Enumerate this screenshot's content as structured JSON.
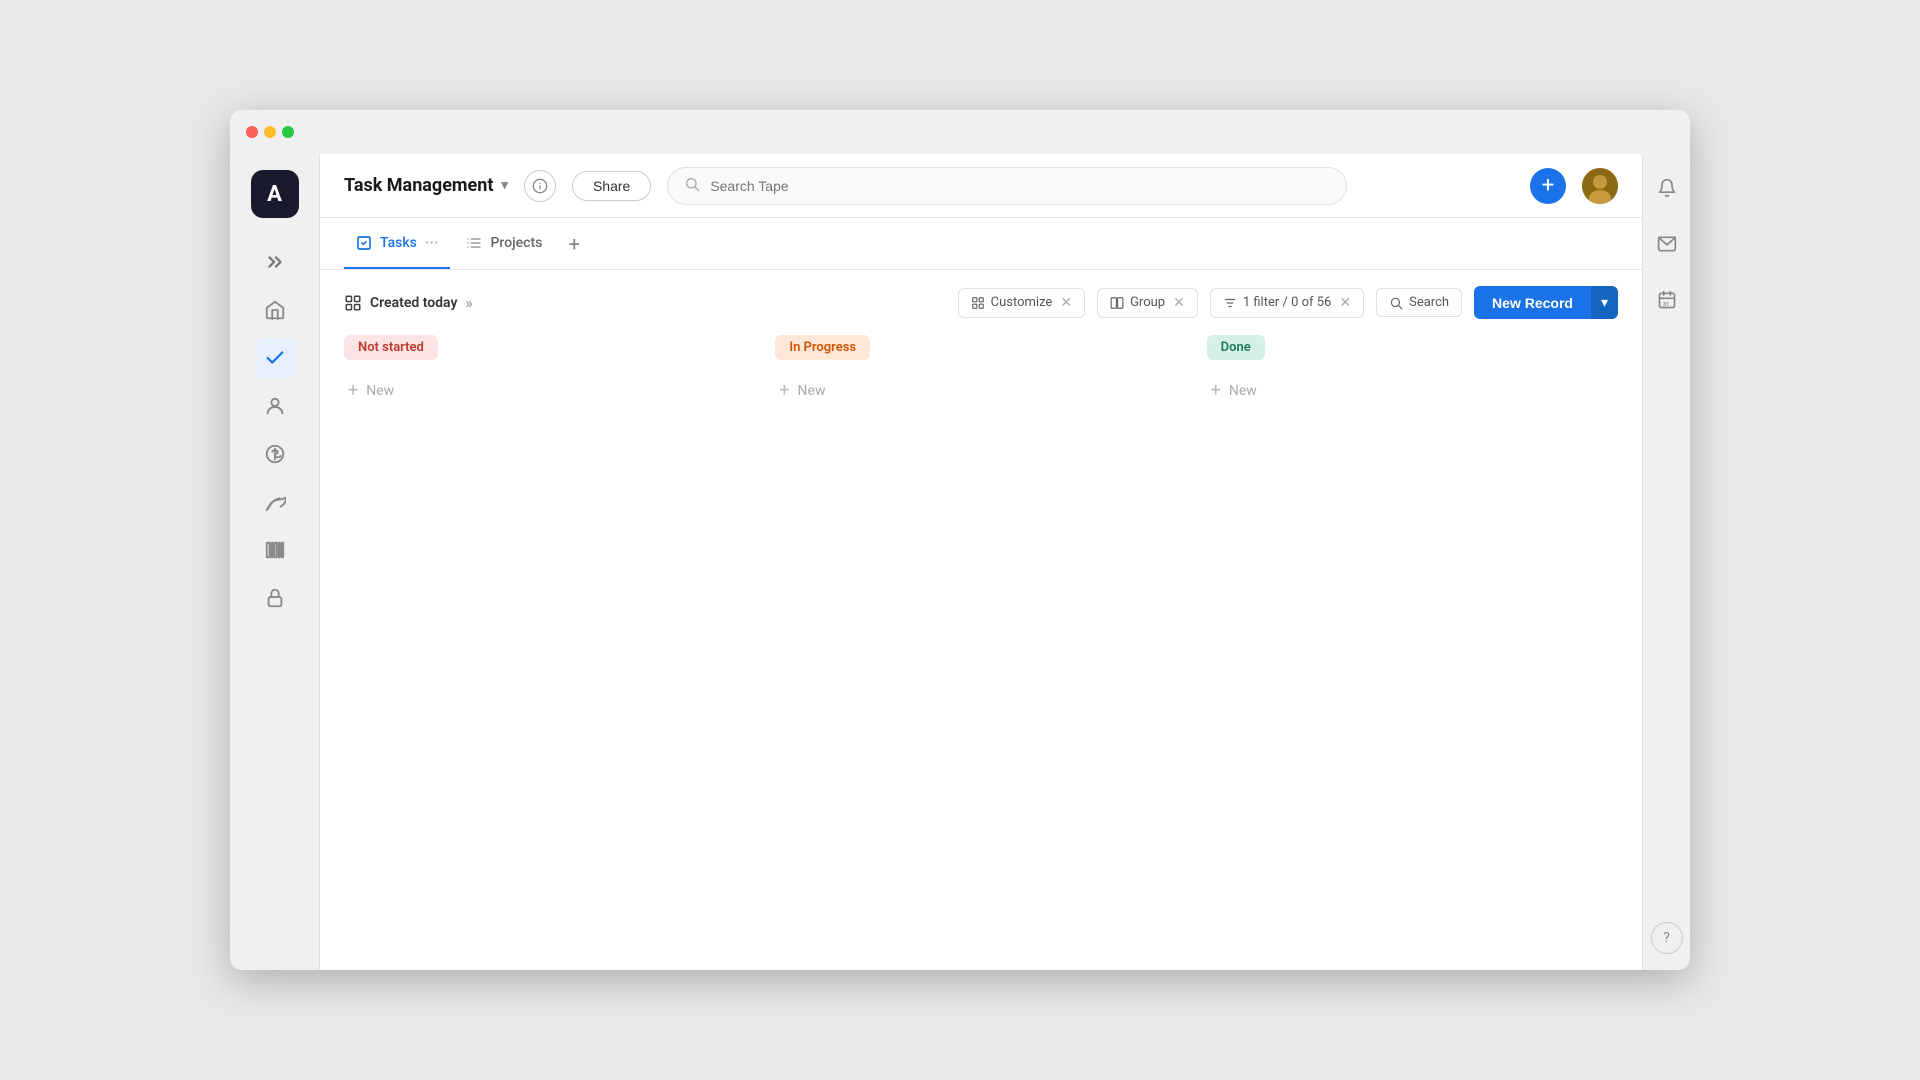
{
  "window": {
    "title": "Task Management"
  },
  "titlebar": {
    "traffic_lights": [
      "red",
      "yellow",
      "green"
    ]
  },
  "topbar": {
    "app_title": "Task Management",
    "chevron_label": "▾",
    "info_label": "ⓘ",
    "share_label": "Share",
    "search_placeholder": "Search Tape",
    "plus_label": "+"
  },
  "tabs": [
    {
      "id": "tasks",
      "label": "Tasks",
      "active": true
    },
    {
      "id": "projects",
      "label": "Projects",
      "active": false
    }
  ],
  "toolbar": {
    "created_today_label": "Created today",
    "customize_label": "Customize",
    "group_label": "Group",
    "filter_label": "1 filter / 0 of 56",
    "search_label": "Search",
    "new_record_label": "New Record"
  },
  "board": {
    "columns": [
      {
        "id": "not-started",
        "label": "Not started",
        "style": "not-started",
        "new_label": "New"
      },
      {
        "id": "in-progress",
        "label": "In Progress",
        "style": "in-progress",
        "new_label": "New"
      },
      {
        "id": "done",
        "label": "Done",
        "style": "done",
        "new_label": "New"
      }
    ]
  },
  "right_sidebar": {
    "icons": [
      {
        "id": "bell",
        "symbol": "🔔"
      },
      {
        "id": "mail",
        "symbol": "✉"
      },
      {
        "id": "calendar",
        "symbol": "📅"
      }
    ],
    "help_label": "?"
  },
  "left_sidebar": {
    "logo_label": "A",
    "icons": [
      {
        "id": "expand",
        "symbol": "⟫",
        "active": false
      },
      {
        "id": "home",
        "symbol": "⌂",
        "active": false
      },
      {
        "id": "tasks-check",
        "symbol": "✔",
        "active": true
      },
      {
        "id": "person",
        "symbol": "👤",
        "active": false
      },
      {
        "id": "dollar",
        "symbol": "＄",
        "active": false
      },
      {
        "id": "leaf",
        "symbol": "🌿",
        "active": false
      },
      {
        "id": "barcode",
        "symbol": "▦",
        "active": false
      },
      {
        "id": "lock",
        "symbol": "🔒",
        "active": false
      }
    ]
  }
}
